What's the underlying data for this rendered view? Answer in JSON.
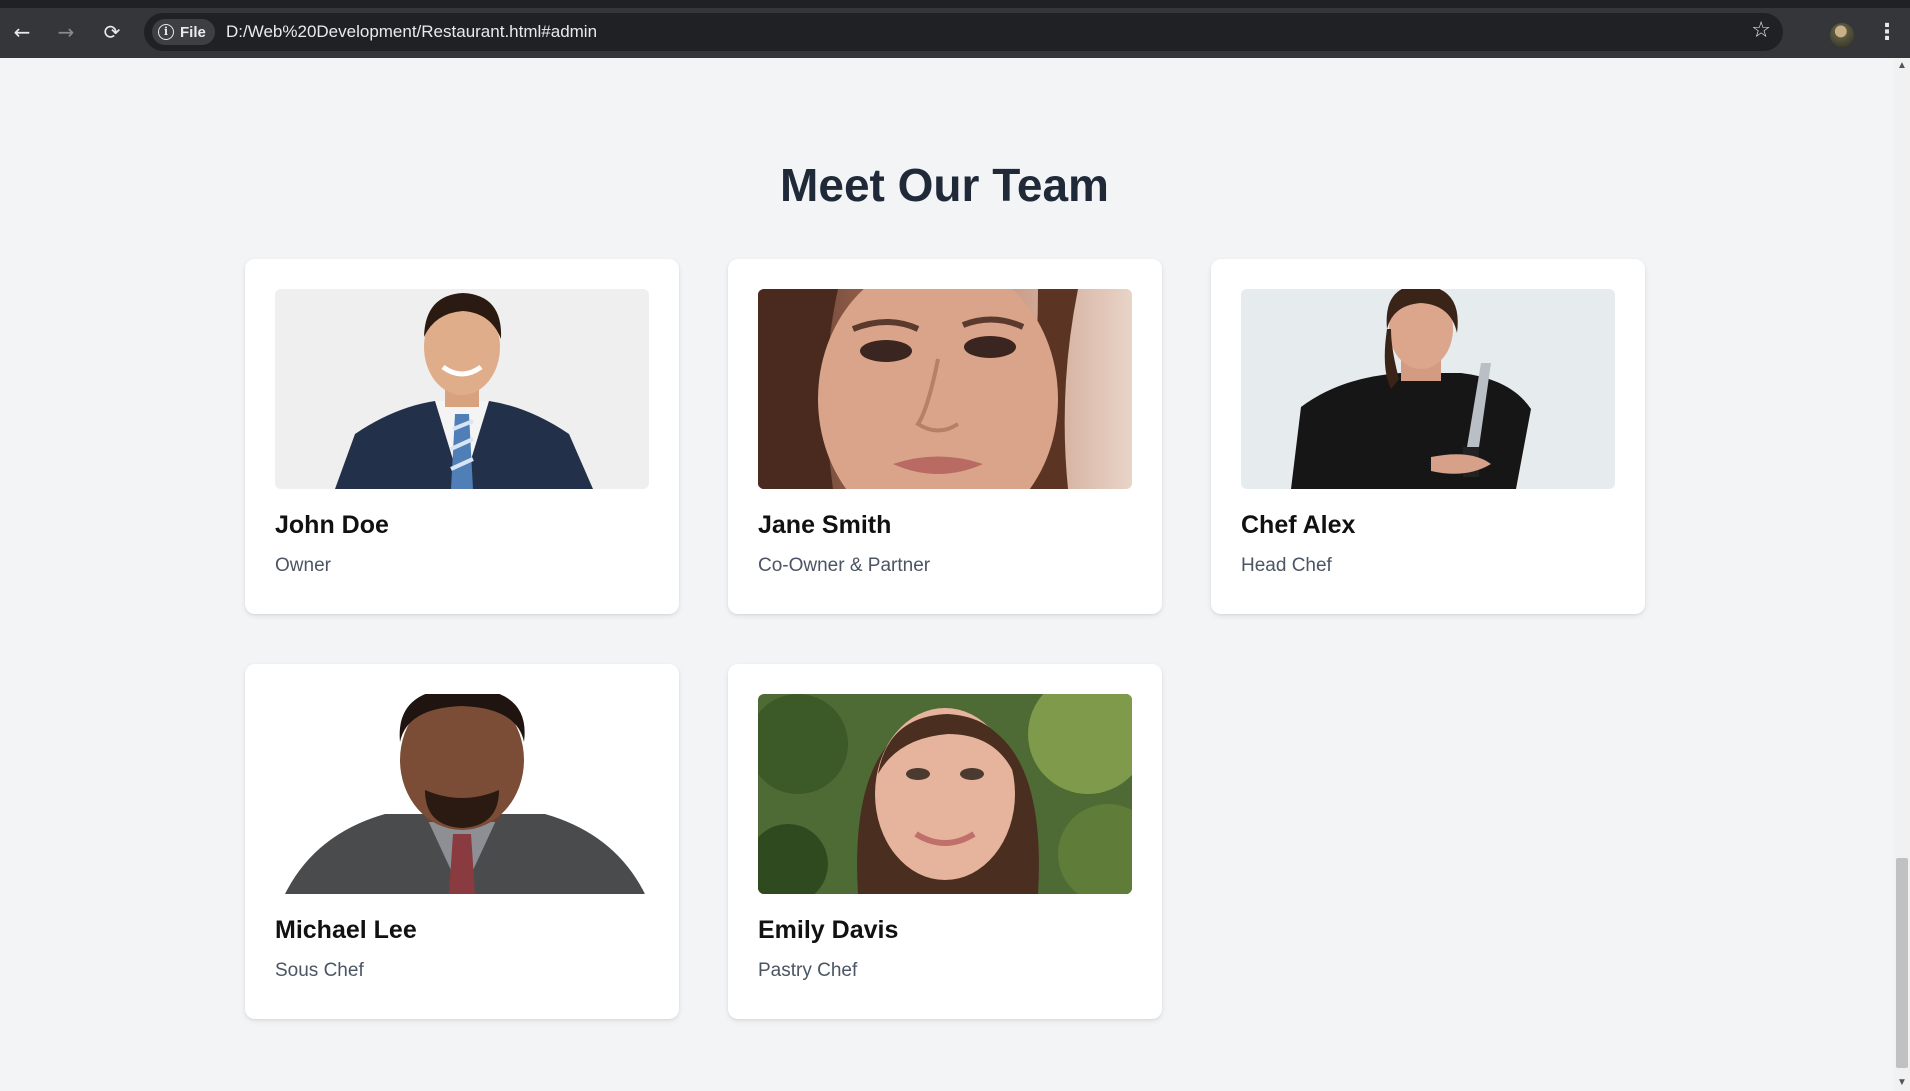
{
  "browser": {
    "back_icon": "←",
    "forward_icon": "→",
    "reload_icon": "⟳",
    "site_info_label": "File",
    "url": "D:/Web%20Development/Restaurant.html#admin",
    "bookmark_icon": "☆",
    "menu_icon": "⋮"
  },
  "team": {
    "title": "Meet Our Team",
    "members": [
      {
        "name": "John Doe",
        "role": "Owner"
      },
      {
        "name": "Jane Smith",
        "role": "Co-Owner & Partner"
      },
      {
        "name": "Chef Alex",
        "role": "Head Chef"
      },
      {
        "name": "Michael Lee",
        "role": "Sous Chef"
      },
      {
        "name": "Emily Davis",
        "role": "Pastry Chef"
      }
    ]
  },
  "scrollbar": {
    "up_icon": "▲",
    "down_icon": "▼"
  }
}
